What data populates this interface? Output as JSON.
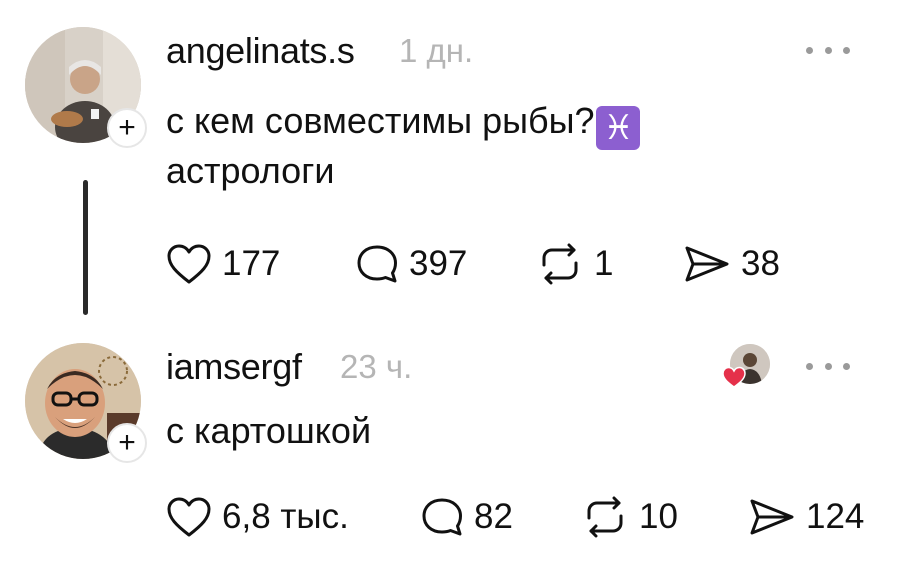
{
  "posts": [
    {
      "username": "angelinats.s",
      "time": "1 дн.",
      "text_line1": "с кем совместимы рыбы?",
      "emoji": "♓",
      "text_line2": "астрологи",
      "follow_glyph": "+",
      "stats": {
        "likes": "177",
        "comments": "397",
        "reposts": "1",
        "shares": "38"
      }
    },
    {
      "username": "iamsergf",
      "time": "23 ч.",
      "text_line1": "с картошкой",
      "follow_glyph": "+",
      "stats": {
        "likes": "6,8 тыс.",
        "comments": "82",
        "reposts": "10",
        "shares": "124"
      }
    }
  ],
  "icons": {
    "like": "heart-icon",
    "comment": "comment-icon",
    "repost": "repost-icon",
    "share": "send-icon",
    "more": "more-icon"
  },
  "colors": {
    "text": "#111111",
    "muted": "#b5b5b5",
    "zodiac_bg": "#8c5fd0",
    "liked_heart": "#e5304a"
  }
}
